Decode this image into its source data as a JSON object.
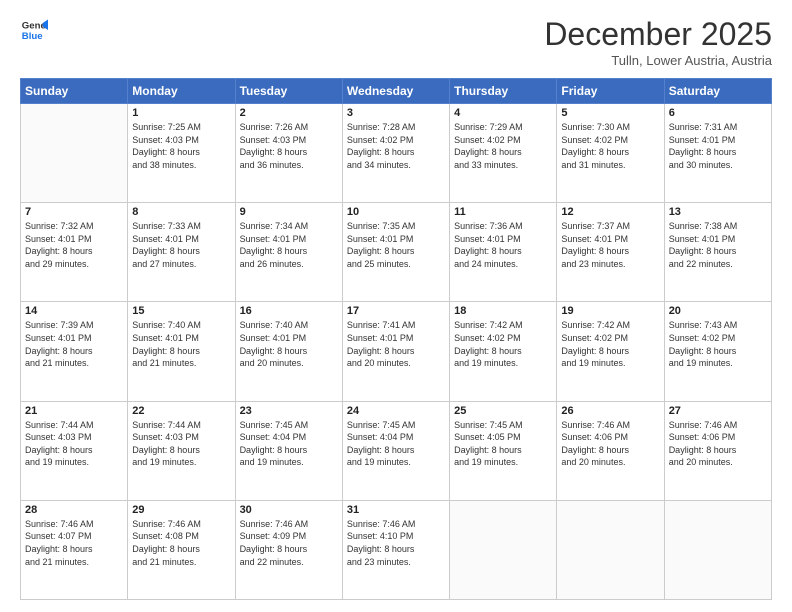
{
  "logo": {
    "line1": "General",
    "line2": "Blue"
  },
  "title": "December 2025",
  "location": "Tulln, Lower Austria, Austria",
  "days_of_week": [
    "Sunday",
    "Monday",
    "Tuesday",
    "Wednesday",
    "Thursday",
    "Friday",
    "Saturday"
  ],
  "weeks": [
    [
      {
        "day": "",
        "info": ""
      },
      {
        "day": "1",
        "info": "Sunrise: 7:25 AM\nSunset: 4:03 PM\nDaylight: 8 hours\nand 38 minutes."
      },
      {
        "day": "2",
        "info": "Sunrise: 7:26 AM\nSunset: 4:03 PM\nDaylight: 8 hours\nand 36 minutes."
      },
      {
        "day": "3",
        "info": "Sunrise: 7:28 AM\nSunset: 4:02 PM\nDaylight: 8 hours\nand 34 minutes."
      },
      {
        "day": "4",
        "info": "Sunrise: 7:29 AM\nSunset: 4:02 PM\nDaylight: 8 hours\nand 33 minutes."
      },
      {
        "day": "5",
        "info": "Sunrise: 7:30 AM\nSunset: 4:02 PM\nDaylight: 8 hours\nand 31 minutes."
      },
      {
        "day": "6",
        "info": "Sunrise: 7:31 AM\nSunset: 4:01 PM\nDaylight: 8 hours\nand 30 minutes."
      }
    ],
    [
      {
        "day": "7",
        "info": "Sunrise: 7:32 AM\nSunset: 4:01 PM\nDaylight: 8 hours\nand 29 minutes."
      },
      {
        "day": "8",
        "info": "Sunrise: 7:33 AM\nSunset: 4:01 PM\nDaylight: 8 hours\nand 27 minutes."
      },
      {
        "day": "9",
        "info": "Sunrise: 7:34 AM\nSunset: 4:01 PM\nDaylight: 8 hours\nand 26 minutes."
      },
      {
        "day": "10",
        "info": "Sunrise: 7:35 AM\nSunset: 4:01 PM\nDaylight: 8 hours\nand 25 minutes."
      },
      {
        "day": "11",
        "info": "Sunrise: 7:36 AM\nSunset: 4:01 PM\nDaylight: 8 hours\nand 24 minutes."
      },
      {
        "day": "12",
        "info": "Sunrise: 7:37 AM\nSunset: 4:01 PM\nDaylight: 8 hours\nand 23 minutes."
      },
      {
        "day": "13",
        "info": "Sunrise: 7:38 AM\nSunset: 4:01 PM\nDaylight: 8 hours\nand 22 minutes."
      }
    ],
    [
      {
        "day": "14",
        "info": "Sunrise: 7:39 AM\nSunset: 4:01 PM\nDaylight: 8 hours\nand 21 minutes."
      },
      {
        "day": "15",
        "info": "Sunrise: 7:40 AM\nSunset: 4:01 PM\nDaylight: 8 hours\nand 21 minutes."
      },
      {
        "day": "16",
        "info": "Sunrise: 7:40 AM\nSunset: 4:01 PM\nDaylight: 8 hours\nand 20 minutes."
      },
      {
        "day": "17",
        "info": "Sunrise: 7:41 AM\nSunset: 4:01 PM\nDaylight: 8 hours\nand 20 minutes."
      },
      {
        "day": "18",
        "info": "Sunrise: 7:42 AM\nSunset: 4:02 PM\nDaylight: 8 hours\nand 19 minutes."
      },
      {
        "day": "19",
        "info": "Sunrise: 7:42 AM\nSunset: 4:02 PM\nDaylight: 8 hours\nand 19 minutes."
      },
      {
        "day": "20",
        "info": "Sunrise: 7:43 AM\nSunset: 4:02 PM\nDaylight: 8 hours\nand 19 minutes."
      }
    ],
    [
      {
        "day": "21",
        "info": "Sunrise: 7:44 AM\nSunset: 4:03 PM\nDaylight: 8 hours\nand 19 minutes."
      },
      {
        "day": "22",
        "info": "Sunrise: 7:44 AM\nSunset: 4:03 PM\nDaylight: 8 hours\nand 19 minutes."
      },
      {
        "day": "23",
        "info": "Sunrise: 7:45 AM\nSunset: 4:04 PM\nDaylight: 8 hours\nand 19 minutes."
      },
      {
        "day": "24",
        "info": "Sunrise: 7:45 AM\nSunset: 4:04 PM\nDaylight: 8 hours\nand 19 minutes."
      },
      {
        "day": "25",
        "info": "Sunrise: 7:45 AM\nSunset: 4:05 PM\nDaylight: 8 hours\nand 19 minutes."
      },
      {
        "day": "26",
        "info": "Sunrise: 7:46 AM\nSunset: 4:06 PM\nDaylight: 8 hours\nand 20 minutes."
      },
      {
        "day": "27",
        "info": "Sunrise: 7:46 AM\nSunset: 4:06 PM\nDaylight: 8 hours\nand 20 minutes."
      }
    ],
    [
      {
        "day": "28",
        "info": "Sunrise: 7:46 AM\nSunset: 4:07 PM\nDaylight: 8 hours\nand 21 minutes."
      },
      {
        "day": "29",
        "info": "Sunrise: 7:46 AM\nSunset: 4:08 PM\nDaylight: 8 hours\nand 21 minutes."
      },
      {
        "day": "30",
        "info": "Sunrise: 7:46 AM\nSunset: 4:09 PM\nDaylight: 8 hours\nand 22 minutes."
      },
      {
        "day": "31",
        "info": "Sunrise: 7:46 AM\nSunset: 4:10 PM\nDaylight: 8 hours\nand 23 minutes."
      },
      {
        "day": "",
        "info": ""
      },
      {
        "day": "",
        "info": ""
      },
      {
        "day": "",
        "info": ""
      }
    ]
  ]
}
